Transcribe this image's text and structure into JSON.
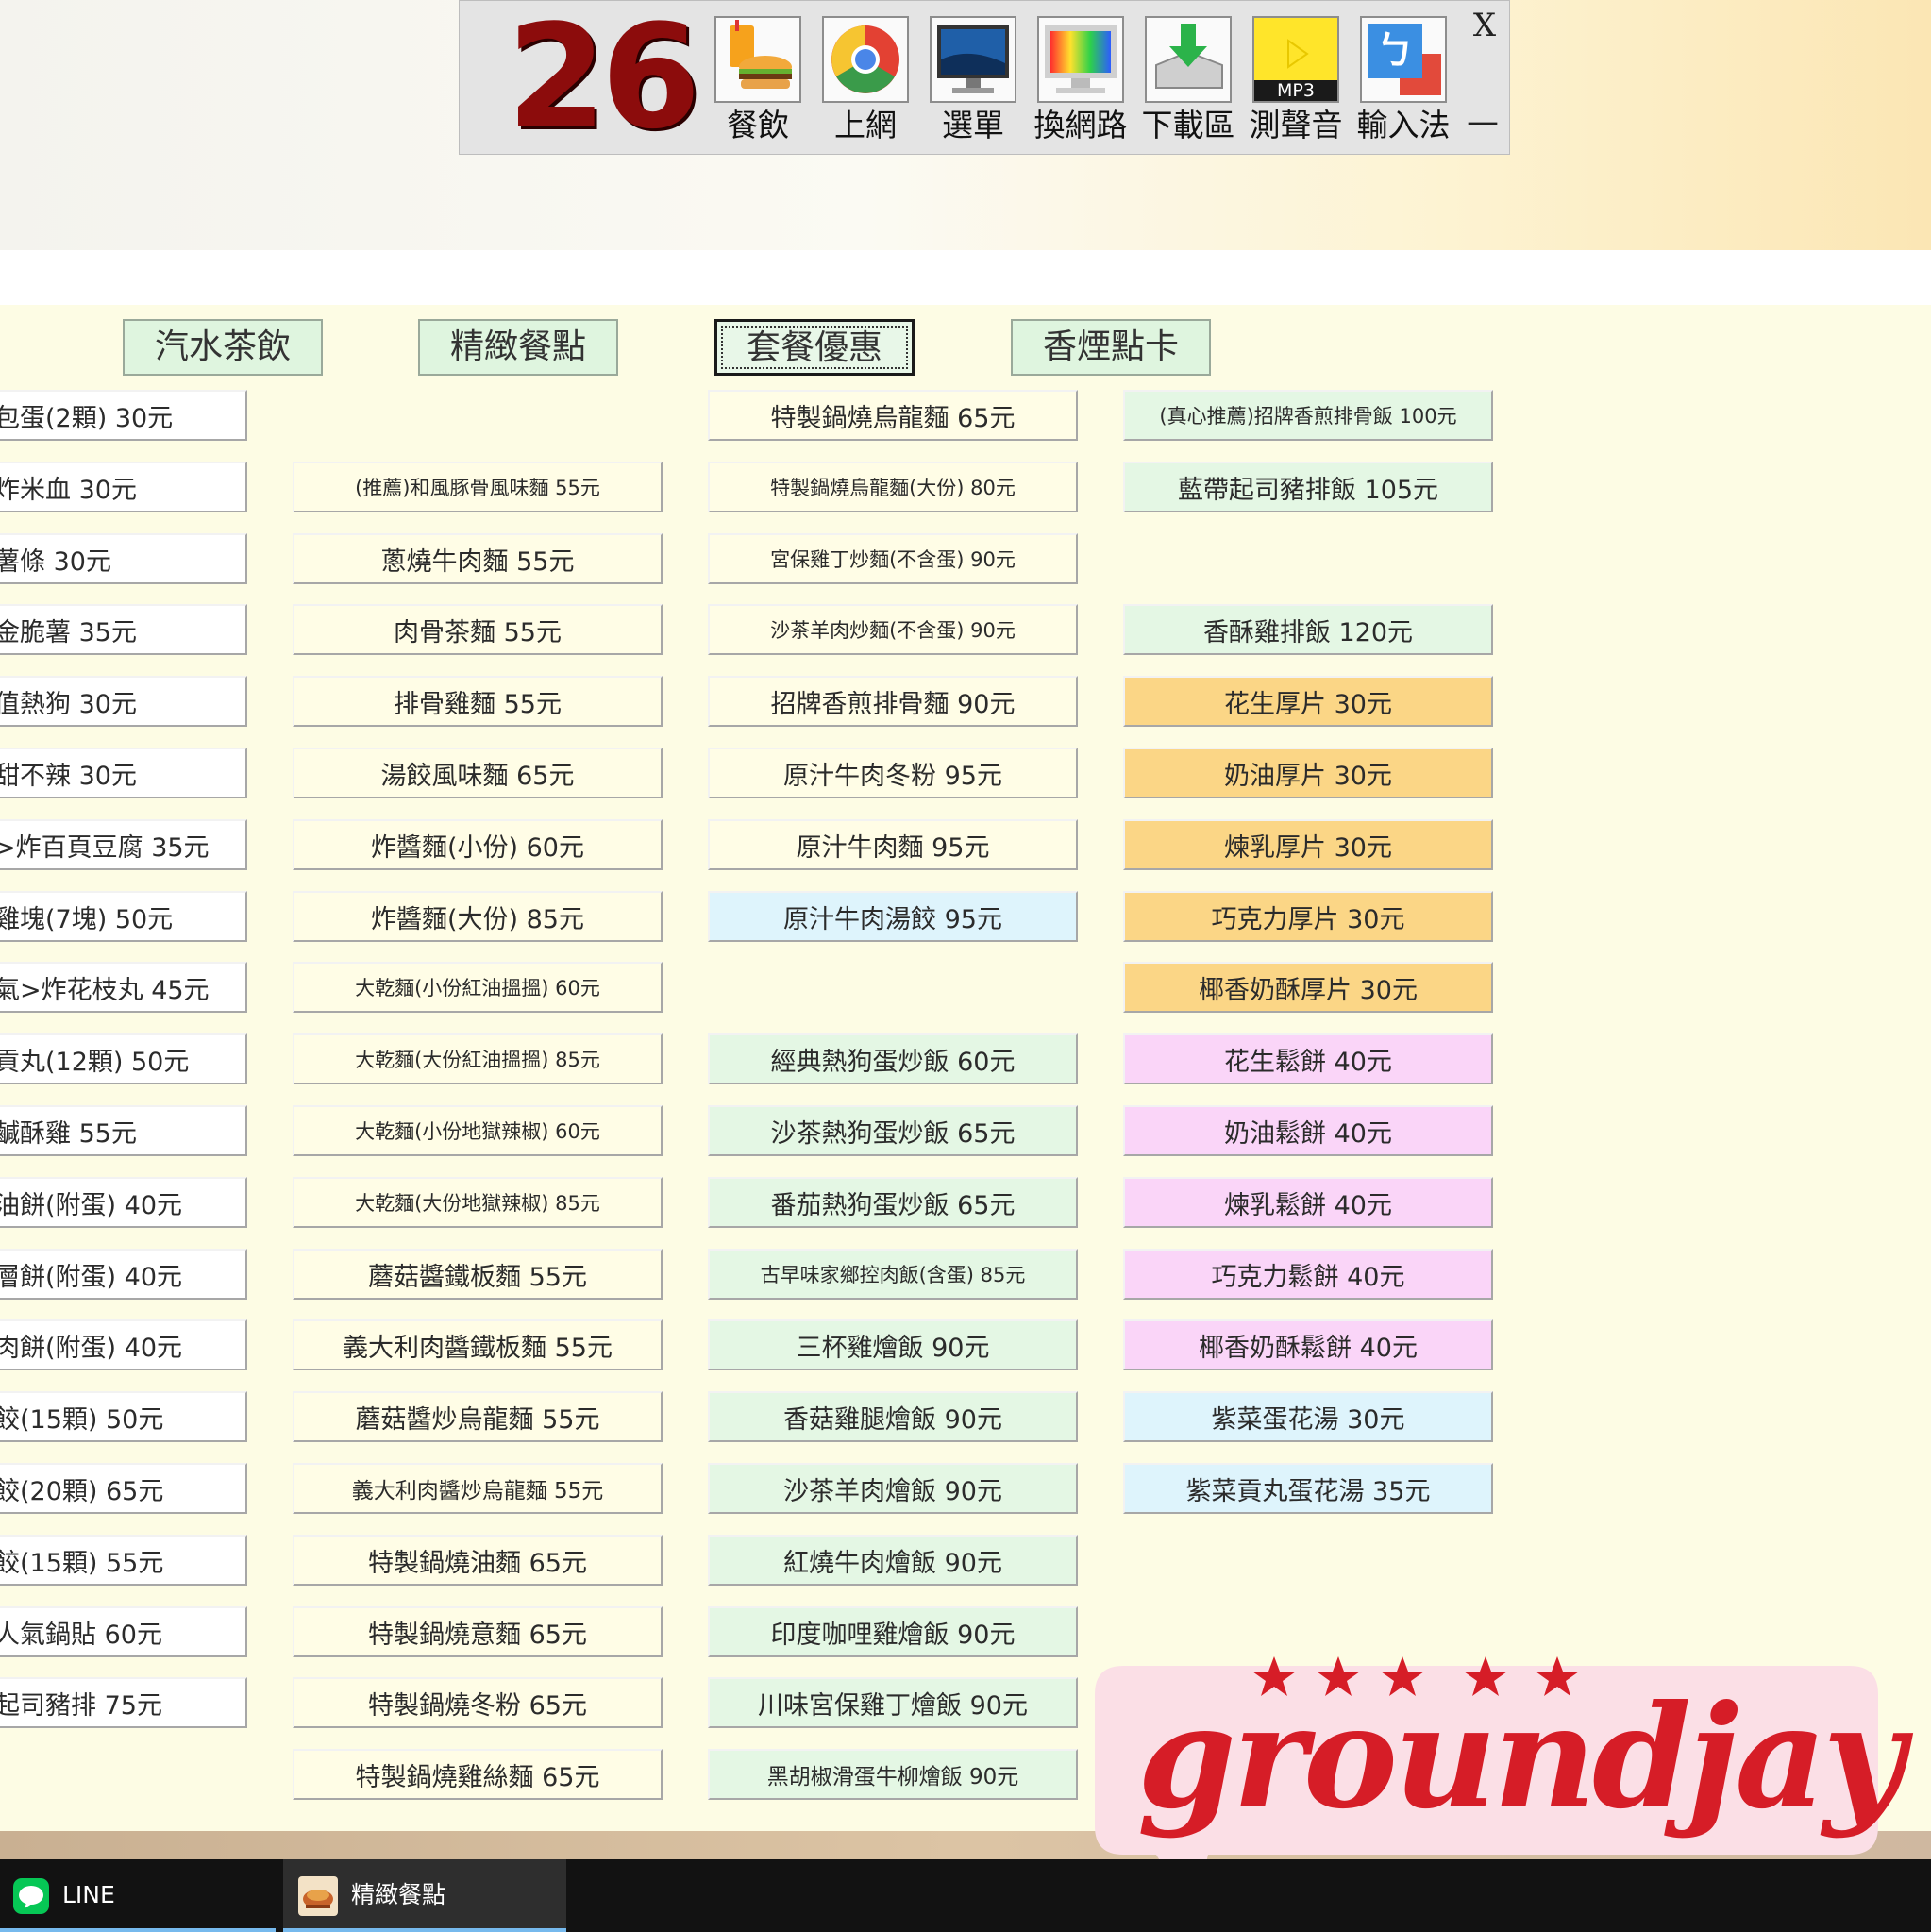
{
  "launcher": {
    "counter": "26",
    "items": [
      {
        "label": "餐飲",
        "icon": "burger-icon"
      },
      {
        "label": "上網",
        "icon": "chrome-icon"
      },
      {
        "label": "選單",
        "icon": "monitor-icon"
      },
      {
        "label": "換網路",
        "icon": "color-monitor-icon"
      },
      {
        "label": "下載區",
        "icon": "download-icon"
      },
      {
        "label": "測聲音",
        "icon": "mp3-icon",
        "badge": "MP3"
      },
      {
        "label": "輸入法",
        "icon": "input-method-icon",
        "glyph": "ㄅ"
      }
    ],
    "close": "X",
    "minimize": "—"
  },
  "tabs": [
    {
      "label": "汽水茶飲",
      "active": false
    },
    {
      "label": "精緻餐點",
      "active": false
    },
    {
      "label": "套餐優惠",
      "active": true
    },
    {
      "label": "香煙點卡",
      "active": false
    }
  ],
  "menu": {
    "col1": [
      "包蛋(2顆) 30元",
      "炸米血 30元",
      "薯條 30元",
      "金脆薯 35元",
      "值熱狗 30元",
      "甜不辣 30元",
      ">炸百頁豆腐 35元",
      "雞塊(7塊) 50元",
      "氣>炸花枝丸 45元",
      "貢丸(12顆) 50元",
      "鹹酥雞 55元",
      "油餅(附蛋) 40元",
      "層餅(附蛋) 40元",
      "肉餅(附蛋) 40元",
      "餃(15顆) 50元",
      "餃(20顆) 65元",
      "餃(15顆) 55元",
      "人氣鍋貼 60元",
      "起司豬排 75元"
    ],
    "col2": [
      "(推薦)和風豚骨風味麵 55元",
      "蔥燒牛肉麵 55元",
      "肉骨茶麵 55元",
      "排骨雞麵 55元",
      "湯餃風味麵 65元",
      "炸醬麵(小份) 60元",
      "炸醬麵(大份) 85元",
      "大乾麵(小份紅油搵搵) 60元",
      "大乾麵(大份紅油搵搵) 85元",
      "大乾麵(小份地獄辣椒) 60元",
      "大乾麵(大份地獄辣椒) 85元",
      "蘑菇醬鐵板麵 55元",
      "義大利肉醬鐵板麵 55元",
      "蘑菇醬炒烏龍麵 55元",
      "義大利肉醬炒烏龍麵 55元",
      "特製鍋燒油麵 65元",
      "特製鍋燒意麵 65元",
      "特製鍋燒冬粉 65元",
      "特製鍋燒雞絲麵 65元"
    ],
    "col3": [
      "特製鍋燒烏龍麵 65元",
      "特製鍋燒烏龍麵(大份) 80元",
      "宮保雞丁炒麵(不含蛋) 90元",
      "沙茶羊肉炒麵(不含蛋) 90元",
      "招牌香煎排骨麵 90元",
      "原汁牛肉冬粉 95元",
      "原汁牛肉麵 95元",
      "原汁牛肉湯餃 95元",
      "經典熱狗蛋炒飯 60元",
      "沙茶熱狗蛋炒飯 65元",
      "番茄熱狗蛋炒飯 65元",
      "古早味家鄉控肉飯(含蛋) 85元",
      "三杯雞燴飯 90元",
      "香菇雞腿燴飯 90元",
      "沙茶羊肉燴飯 90元",
      "紅燒牛肉燴飯 90元",
      "印度咖哩雞燴飯 90元",
      "川味宮保雞丁燴飯 90元",
      "黑胡椒滑蛋牛柳燴飯 90元"
    ],
    "col4": [
      "(真心推薦)招牌香煎排骨飯 100元",
      "藍帶起司豬排飯 105元",
      "香酥雞排飯 120元",
      "花生厚片 30元",
      "奶油厚片 30元",
      "煉乳厚片 30元",
      "巧克力厚片 30元",
      "椰香奶酥厚片 30元",
      "花生鬆餅 40元",
      "奶油鬆餅 40元",
      "煉乳鬆餅 40元",
      "巧克力鬆餅 40元",
      "椰香奶酥鬆餅 40元",
      "紫菜蛋花湯 30元",
      "紫菜貢丸蛋花湯 35元"
    ]
  },
  "taskbar": {
    "items": [
      {
        "label": "LINE",
        "icon": "line-icon"
      },
      {
        "label": "精緻餐點",
        "icon": "food-app-icon"
      }
    ]
  },
  "watermark": {
    "text": "groundjay",
    "stars": 5
  },
  "colors": {
    "accent_counter": "#8c0c0c",
    "watermark": "#d61d27",
    "watermark_bg": "#fbdfe6",
    "menu_bg": "#fdfce4"
  }
}
